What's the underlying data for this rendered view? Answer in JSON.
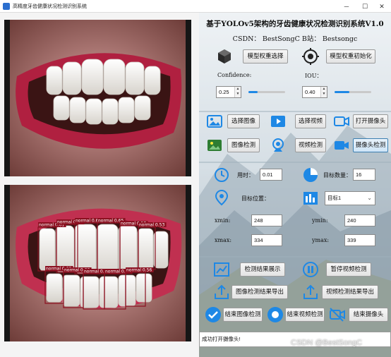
{
  "window": {
    "title": "高精度牙齿健康状况检测识别系统",
    "minimize_glyph": "─",
    "maximize_glyph": "☐",
    "close_glyph": "✕"
  },
  "header": {
    "title": "基于YOLOv5架构的牙齿健康状况检测识别系统V1.0",
    "subtitle": "CSDN：  BestSongC   B站：  Bestsongc"
  },
  "model": {
    "select_weights_label": "模型权重选择",
    "init_weights_label": "模型权重初始化",
    "confidence_label": "Confidence:",
    "confidence_value": "0.25",
    "confidence_fraction": 0.25,
    "iou_label": "IOU：",
    "iou_value": "0.40",
    "iou_fraction": 0.4
  },
  "input": {
    "select_image_label": "选择图像",
    "select_video_label": "选择视频",
    "open_camera_label": "打开摄像头",
    "image_detect_label": "图像检测",
    "video_detect_label": "视频检测",
    "camera_detect_label": "摄像头检测"
  },
  "results": {
    "time_label": "用时：",
    "time_value": "0.01",
    "count_label": "目标数量：",
    "count_value": "16",
    "position_label": "目标位置：",
    "target_select_value": "目标1",
    "xmin_label": "xmin:",
    "xmin_value": "248",
    "ymin_label": "ymin:",
    "ymin_value": "240",
    "xmax_label": "xmax:",
    "xmax_value": "334",
    "ymax_label": "ymax:",
    "ymax_value": "339"
  },
  "actions": {
    "show_results_label": "检测结果展示",
    "pause_video_label": "暂停视频检测",
    "export_image_label": "图像检测结果导出",
    "export_video_label": "视频检测结果导出",
    "end_image_label": "结束图像检测",
    "end_video_label": "结束视频检测",
    "end_camera_label": "结束摄像头"
  },
  "status": {
    "message": "成功打开摄像头!"
  },
  "detections": {
    "class_name": "normal",
    "items": [
      {
        "label": "normal 0.61"
      },
      {
        "label": "normal 0.57"
      },
      {
        "label": "normal 0.64"
      },
      {
        "label": "normal 0.65"
      },
      {
        "label": "normal 0.58"
      },
      {
        "label": "normal 0.53"
      },
      {
        "label": "normal 0.60"
      },
      {
        "label": "normal 0.66"
      },
      {
        "label": "normal 0.66"
      },
      {
        "label": "normal 0.63"
      },
      {
        "label": "normal 0.56"
      }
    ]
  },
  "watermark": "CSDN @BestSongC",
  "colors": {
    "accent": "#1e88e5",
    "box": "#8b1020",
    "label_bg": "#8b1020"
  }
}
